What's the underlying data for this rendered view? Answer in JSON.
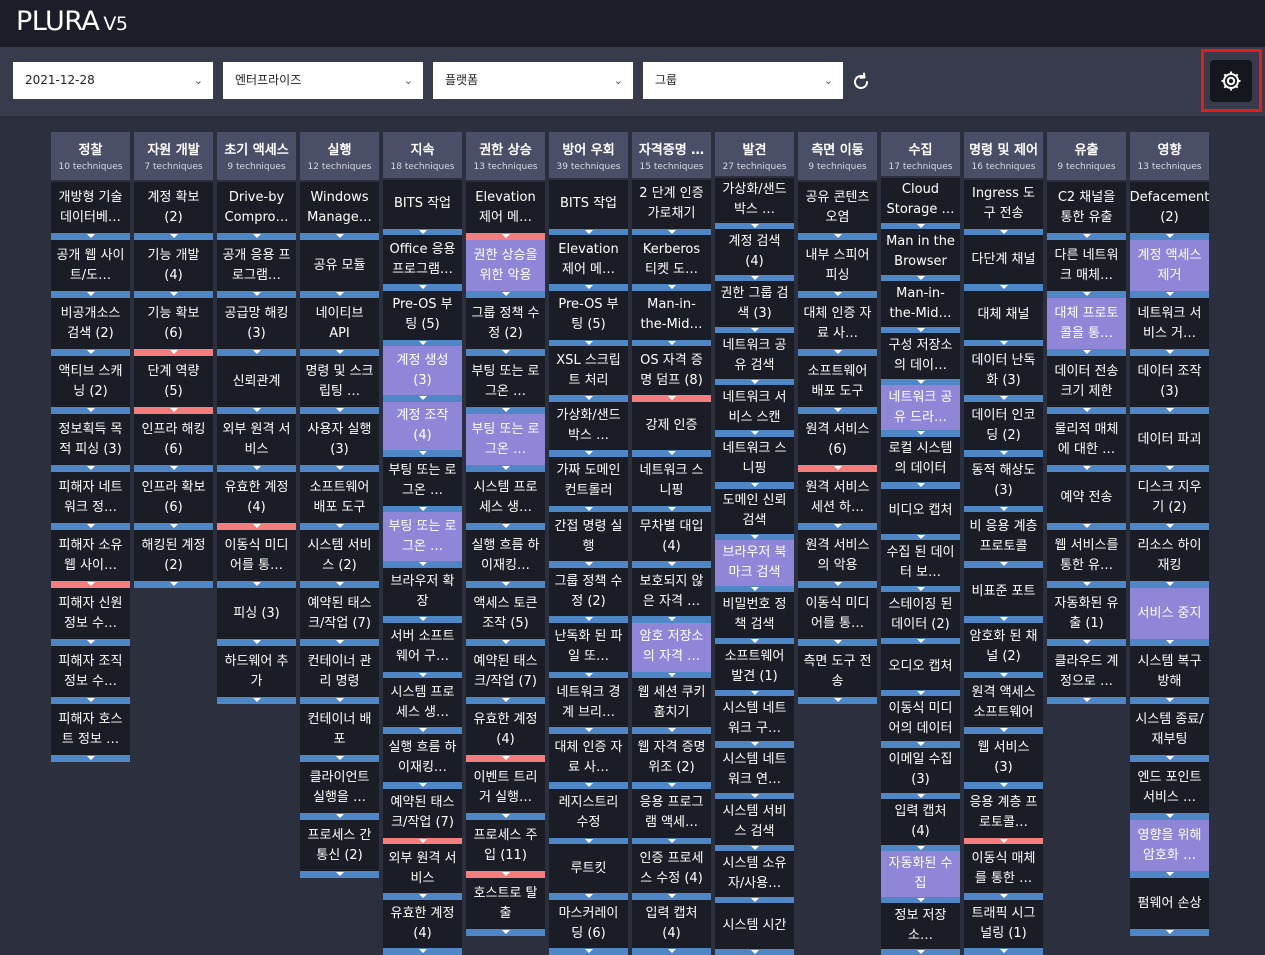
{
  "app": {
    "name": "PLURA",
    "version": "V5"
  },
  "filters": [
    {
      "value": "2021-12-28"
    },
    {
      "value": "엔터프라이즈"
    },
    {
      "value": "플랫폼"
    },
    {
      "value": "그룹"
    }
  ],
  "icons": {
    "refresh": "refresh-icon",
    "settings": "gear-icon",
    "dropdown": "chevron-down-icon"
  },
  "colors": {
    "highlight": "#8f86d8",
    "bar_blue": "#4f86c6",
    "bar_red": "#f47e7e",
    "header": "#4a4e66",
    "cell": "#1b1d26",
    "settings_outline": "#e21b1b"
  },
  "tactics": [
    {
      "name": "정찰",
      "count": "10 techniques",
      "items": [
        {
          "t": "개방형 기술 데이터베…",
          "h": false,
          "r": false
        },
        {
          "t": "공개 웹 사이트/도…",
          "h": false,
          "r": false
        },
        {
          "t": "비공개소스 검색 (2)",
          "h": false,
          "r": false
        },
        {
          "t": "액티브 스캐닝 (2)",
          "h": false,
          "r": false
        },
        {
          "t": "정보획득 목적 피싱 (3)",
          "h": false,
          "r": false
        },
        {
          "t": "피해자 네트워크 정…",
          "h": false,
          "r": false
        },
        {
          "t": "피해자 소유 웹 사이…",
          "h": false,
          "r": true
        },
        {
          "t": "피해자 신원 정보 수…",
          "h": false,
          "r": false
        },
        {
          "t": "피해자 조직 정보 수…",
          "h": false,
          "r": false
        },
        {
          "t": "피해자 호스트 정보 …",
          "h": false,
          "r": false
        }
      ]
    },
    {
      "name": "자원 개발",
      "count": "7 techniques",
      "items": [
        {
          "t": "계정 확보 (2)",
          "h": false,
          "r": false
        },
        {
          "t": "기능 개발 (4)",
          "h": false,
          "r": false
        },
        {
          "t": "기능 확보 (6)",
          "h": false,
          "r": true
        },
        {
          "t": "단계 역량 (5)",
          "h": false,
          "r": true
        },
        {
          "t": "인프라 해킹 (6)",
          "h": false,
          "r": false
        },
        {
          "t": "인프라 확보 (6)",
          "h": false,
          "r": false
        },
        {
          "t": "해킹된 계정 (2)",
          "h": false,
          "r": false
        }
      ]
    },
    {
      "name": "초기 액세스",
      "count": "9 techniques",
      "items": [
        {
          "t": "Drive-by Compro…",
          "h": false,
          "r": false
        },
        {
          "t": "공개 응용 프로그램…",
          "h": false,
          "r": false
        },
        {
          "t": "공급망 해킹 (3)",
          "h": false,
          "r": false
        },
        {
          "t": "신뢰관계",
          "h": false,
          "r": false
        },
        {
          "t": "외부 원격 서비스",
          "h": false,
          "r": false
        },
        {
          "t": "유효한 계정 (4)",
          "h": false,
          "r": true
        },
        {
          "t": "이동식 미디어를 통…",
          "h": false,
          "r": false
        },
        {
          "t": "피싱 (3)",
          "h": false,
          "r": false
        },
        {
          "t": "하드웨어 추가",
          "h": false,
          "r": false
        }
      ]
    },
    {
      "name": "실행",
      "count": "12 techniques",
      "items": [
        {
          "t": "Windows Manage…",
          "h": false,
          "r": false
        },
        {
          "t": "공유 모듈",
          "h": false,
          "r": false
        },
        {
          "t": "네이티브 API",
          "h": false,
          "r": false
        },
        {
          "t": "명령 및 스크립팅 …",
          "h": false,
          "r": false
        },
        {
          "t": "사용자 실행 (3)",
          "h": false,
          "r": false
        },
        {
          "t": "소프트웨어 배포 도구",
          "h": false,
          "r": false
        },
        {
          "t": "시스템 서비스 (2)",
          "h": false,
          "r": false
        },
        {
          "t": "예약된 태스크/작업 (7)",
          "h": false,
          "r": false
        },
        {
          "t": "컨테이너 관리 명령",
          "h": false,
          "r": false
        },
        {
          "t": "컨테이너 배포",
          "h": false,
          "r": false
        },
        {
          "t": "클라이언트 실행을 …",
          "h": false,
          "r": false
        },
        {
          "t": "프로세스 간 통신 (2)",
          "h": false,
          "r": false
        }
      ]
    },
    {
      "name": "지속",
      "count": "18 techniques",
      "items": [
        {
          "t": "BITS 작업",
          "h": false,
          "r": false
        },
        {
          "t": "Office 응용 프로그램…",
          "h": false,
          "r": false
        },
        {
          "t": "Pre-OS 부팅 (5)",
          "h": false,
          "r": false
        },
        {
          "t": "계정 생성 (3)",
          "h": true,
          "r": false
        },
        {
          "t": "계정 조작 (4)",
          "h": true,
          "r": false
        },
        {
          "t": "부팅 또는 로그온 …",
          "h": false,
          "r": false
        },
        {
          "t": "부팅 또는 로그온 …",
          "h": true,
          "r": false
        },
        {
          "t": "브라우저 확장",
          "h": false,
          "r": false
        },
        {
          "t": "서버 소프트웨어 구…",
          "h": false,
          "r": false
        },
        {
          "t": "시스템 프로세스 생…",
          "h": false,
          "r": false
        },
        {
          "t": "실행 흐름 하이재킹…",
          "h": false,
          "r": false
        },
        {
          "t": "예약된 태스크/작업 (7)",
          "h": false,
          "r": true
        },
        {
          "t": "외부 원격 서비스",
          "h": false,
          "r": false
        },
        {
          "t": "유효한 계정 (4)",
          "h": false,
          "r": false
        }
      ]
    },
    {
      "name": "권한 상승",
      "count": "13 techniques",
      "items": [
        {
          "t": "Elevation 제어 메…",
          "h": false,
          "r": true
        },
        {
          "t": "권한 상승을 위한 악용",
          "h": true,
          "r": false
        },
        {
          "t": "그룹 정책 수정 (2)",
          "h": false,
          "r": false
        },
        {
          "t": "부팅 또는 로그온 …",
          "h": false,
          "r": false
        },
        {
          "t": "부팅 또는 로그온 …",
          "h": true,
          "r": false
        },
        {
          "t": "시스템 프로세스 생…",
          "h": false,
          "r": false
        },
        {
          "t": "실행 흐름 하이재킹…",
          "h": false,
          "r": false
        },
        {
          "t": "액세스 토큰 조작 (5)",
          "h": false,
          "r": false
        },
        {
          "t": "예약된 태스크/작업 (7)",
          "h": false,
          "r": false
        },
        {
          "t": "유효한 계정 (4)",
          "h": false,
          "r": true
        },
        {
          "t": "이벤트 트리거 실행…",
          "h": false,
          "r": false
        },
        {
          "t": "프로세스 주입 (11)",
          "h": false,
          "r": true
        },
        {
          "t": "호스트로 탈출",
          "h": false,
          "r": false
        }
      ]
    },
    {
      "name": "방어 우회",
      "count": "39 techniques",
      "items": [
        {
          "t": "BITS 작업",
          "h": false,
          "r": false
        },
        {
          "t": "Elevation 제어 메…",
          "h": false,
          "r": false
        },
        {
          "t": "Pre-OS 부팅 (5)",
          "h": false,
          "r": false
        },
        {
          "t": "XSL 스크립트 처리",
          "h": false,
          "r": false
        },
        {
          "t": "가상화/샌드 박스 …",
          "h": false,
          "r": false
        },
        {
          "t": "가짜 도메인 컨트롤러",
          "h": false,
          "r": false
        },
        {
          "t": "간접 명령 실행",
          "h": false,
          "r": false
        },
        {
          "t": "그룹 정책 수정 (2)",
          "h": false,
          "r": false
        },
        {
          "t": "난독화 된 파일 또…",
          "h": false,
          "r": false
        },
        {
          "t": "네트워크 경계 브리…",
          "h": false,
          "r": false
        },
        {
          "t": "대체 인증 자료 사…",
          "h": false,
          "r": false
        },
        {
          "t": "레지스트리 수정",
          "h": false,
          "r": false
        },
        {
          "t": "루트킷",
          "h": false,
          "r": false
        },
        {
          "t": "마스커레이딩 (6)",
          "h": false,
          "r": false
        }
      ]
    },
    {
      "name": "자격증명 …",
      "count": "15 techniques",
      "items": [
        {
          "t": "2 단계 인증 가로채기",
          "h": false,
          "r": false
        },
        {
          "t": "Kerberos 티켓 도…",
          "h": false,
          "r": false
        },
        {
          "t": "Man-in-the-Mid…",
          "h": false,
          "r": false
        },
        {
          "t": "OS 자격 증명 덤프 (8)",
          "h": false,
          "r": true
        },
        {
          "t": "강제 인증",
          "h": false,
          "r": false
        },
        {
          "t": "네트워크 스니핑",
          "h": false,
          "r": false
        },
        {
          "t": "무차별 대입 (4)",
          "h": false,
          "r": false
        },
        {
          "t": "보호되지 않은 자격 …",
          "h": false,
          "r": false
        },
        {
          "t": "암호 저장소의 자격 …",
          "h": true,
          "r": false
        },
        {
          "t": "웹 세션 쿠키 훔치기",
          "h": false,
          "r": false
        },
        {
          "t": "웹 자격 증명 위조 (2)",
          "h": false,
          "r": false
        },
        {
          "t": "응용 프로그램 액세…",
          "h": false,
          "r": false
        },
        {
          "t": "인증 프로세스 수정 (4)",
          "h": false,
          "r": false
        },
        {
          "t": "입력 캡처 (4)",
          "h": false,
          "r": false
        }
      ]
    },
    {
      "name": "발견",
      "count": "27 techniques",
      "items": [
        {
          "t": "가상화/샌드 박스 …",
          "h": false,
          "r": false
        },
        {
          "t": "계정 검색 (4)",
          "h": false,
          "r": false
        },
        {
          "t": "권한 그룹 검색 (3)",
          "h": false,
          "r": false
        },
        {
          "t": "네트워크 공유 검색",
          "h": false,
          "r": false
        },
        {
          "t": "네트워크 서비스 스캔",
          "h": false,
          "r": false
        },
        {
          "t": "네트워크 스니핑",
          "h": false,
          "r": false
        },
        {
          "t": "도메인 신뢰 검색",
          "h": false,
          "r": false
        },
        {
          "t": "브라우저 북마크 검색",
          "h": true,
          "r": false
        },
        {
          "t": "비밀번호 정책 검색",
          "h": false,
          "r": false
        },
        {
          "t": "소프트웨어 발견 (1)",
          "h": false,
          "r": false
        },
        {
          "t": "시스템 네트워크 구…",
          "h": false,
          "r": false
        },
        {
          "t": "시스템 네트워크 연…",
          "h": false,
          "r": false
        },
        {
          "t": "시스템 서비스 검색",
          "h": false,
          "r": false
        },
        {
          "t": "시스템 소유자/사용…",
          "h": false,
          "r": false
        },
        {
          "t": "시스템 시간",
          "h": false,
          "r": false
        }
      ]
    },
    {
      "name": "측면 이동",
      "count": "9 techniques",
      "items": [
        {
          "t": "공유 콘텐츠 오염",
          "h": false,
          "r": false
        },
        {
          "t": "내부 스피어 피싱",
          "h": false,
          "r": false
        },
        {
          "t": "대체 인증 자료 사…",
          "h": false,
          "r": false
        },
        {
          "t": "소프트웨어 배포 도구",
          "h": false,
          "r": false
        },
        {
          "t": "원격 서비스 (6)",
          "h": false,
          "r": true
        },
        {
          "t": "원격 서비스 세션 하…",
          "h": false,
          "r": false
        },
        {
          "t": "원격 서비스의 악용",
          "h": false,
          "r": false
        },
        {
          "t": "이동식 미디어를 통…",
          "h": false,
          "r": false
        },
        {
          "t": "측면 도구 전송",
          "h": false,
          "r": false
        }
      ]
    },
    {
      "name": "수집",
      "count": "17 techniques",
      "items": [
        {
          "t": "Cloud Storage …",
          "h": false,
          "r": false
        },
        {
          "t": "Man in the Browser",
          "h": false,
          "r": false
        },
        {
          "t": "Man-in-the-Mid…",
          "h": false,
          "r": false
        },
        {
          "t": "구성 저장소의 데이…",
          "h": false,
          "r": false
        },
        {
          "t": "네트워크 공유 드라…",
          "h": true,
          "r": false
        },
        {
          "t": "로컬 시스템의 데이터",
          "h": false,
          "r": false
        },
        {
          "t": "비디오 캡처",
          "h": false,
          "r": false
        },
        {
          "t": "수집 된 데이터 보…",
          "h": false,
          "r": false
        },
        {
          "t": "스테이징 된 데이터 (2)",
          "h": false,
          "r": false
        },
        {
          "t": "오디오 캡처",
          "h": false,
          "r": false
        },
        {
          "t": "이동식 미디어의 데이터",
          "h": false,
          "r": false
        },
        {
          "t": "이메일 수집 (3)",
          "h": false,
          "r": false
        },
        {
          "t": "입력 캡처 (4)",
          "h": false,
          "r": false
        },
        {
          "t": "자동화된 수집",
          "h": true,
          "r": false
        },
        {
          "t": "정보 저장소…",
          "h": false,
          "r": false
        }
      ]
    },
    {
      "name": "명령 및 제어",
      "count": "16 techniques",
      "items": [
        {
          "t": "Ingress 도구 전송",
          "h": false,
          "r": false
        },
        {
          "t": "다단계 채널",
          "h": false,
          "r": false
        },
        {
          "t": "대체 채널",
          "h": false,
          "r": false
        },
        {
          "t": "데이터 난독화 (3)",
          "h": false,
          "r": false
        },
        {
          "t": "데이터 인코딩 (2)",
          "h": false,
          "r": false
        },
        {
          "t": "동적 해상도 (3)",
          "h": false,
          "r": false
        },
        {
          "t": "비 응용 계층 프로토콜",
          "h": false,
          "r": false
        },
        {
          "t": "비표준 포트",
          "h": false,
          "r": false
        },
        {
          "t": "암호화 된 채널 (2)",
          "h": false,
          "r": false
        },
        {
          "t": "원격 액세스 소프트웨어",
          "h": false,
          "r": false
        },
        {
          "t": "웹 서비스 (3)",
          "h": false,
          "r": false
        },
        {
          "t": "응용 계층 프로토콜…",
          "h": false,
          "r": true
        },
        {
          "t": "이동식 매체를 통한 …",
          "h": false,
          "r": false
        },
        {
          "t": "트래픽 시그널링 (1)",
          "h": false,
          "r": false
        }
      ]
    },
    {
      "name": "유출",
      "count": "9 techniques",
      "items": [
        {
          "t": "C2 채널을 통한 유출",
          "h": false,
          "r": false
        },
        {
          "t": "다른 네트워크 매체…",
          "h": false,
          "r": false
        },
        {
          "t": "대체 프로토콜을 통…",
          "h": true,
          "r": false
        },
        {
          "t": "데이터 전송 크기 제한",
          "h": false,
          "r": false
        },
        {
          "t": "물리적 매체에 대한 …",
          "h": false,
          "r": false
        },
        {
          "t": "예약 전송",
          "h": false,
          "r": false
        },
        {
          "t": "웹 서비스를 통한 유…",
          "h": false,
          "r": false
        },
        {
          "t": "자동화된 유출 (1)",
          "h": false,
          "r": false
        },
        {
          "t": "클라우드 계정으로 …",
          "h": false,
          "r": false
        }
      ]
    },
    {
      "name": "영향",
      "count": "13 techniques",
      "items": [
        {
          "t": "Defacement (2)",
          "h": false,
          "r": false
        },
        {
          "t": "계정 액세스 제거",
          "h": true,
          "r": false
        },
        {
          "t": "네트워크 서비스 거…",
          "h": false,
          "r": false
        },
        {
          "t": "데이터 조작 (3)",
          "h": false,
          "r": false
        },
        {
          "t": "데이터 파괴",
          "h": false,
          "r": false
        },
        {
          "t": "디스크 지우기 (2)",
          "h": false,
          "r": false
        },
        {
          "t": "리소스 하이재킹",
          "h": false,
          "r": false
        },
        {
          "t": "서비스 중지",
          "h": true,
          "r": false
        },
        {
          "t": "시스템 복구 방해",
          "h": false,
          "r": false
        },
        {
          "t": "시스템 종료/재부팅",
          "h": false,
          "r": false
        },
        {
          "t": "엔드 포인트 서비스 …",
          "h": false,
          "r": false
        },
        {
          "t": "영향을 위해 암호화 …",
          "h": true,
          "r": false
        },
        {
          "t": "펌웨어 손상",
          "h": false,
          "r": false
        }
      ]
    }
  ]
}
